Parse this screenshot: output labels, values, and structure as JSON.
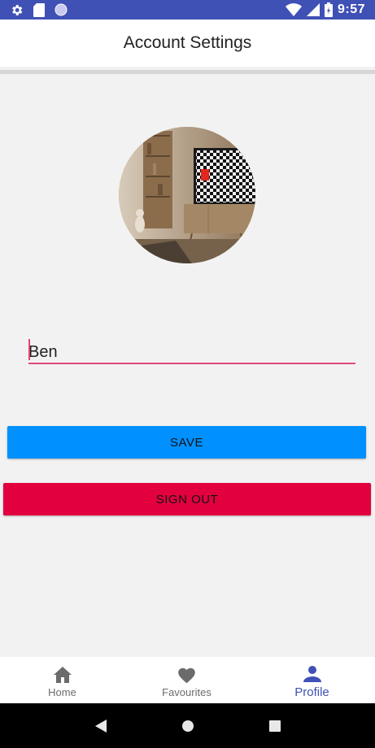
{
  "status_bar": {
    "time": "9:57",
    "bg_color": "#3f51b5",
    "icons_left": [
      "gear-icon",
      "sd-card-icon",
      "circle-notification-icon"
    ],
    "icons_right": [
      "wifi-icon",
      "signal-icon",
      "battery-icon"
    ]
  },
  "app_bar": {
    "title": "Account Settings"
  },
  "profile": {
    "avatar_alt": "profile-photo",
    "name_value": "Ben",
    "input_underline_color": "#e04a7b"
  },
  "actions": {
    "save_label": "SAVE",
    "save_color": "#0090ff",
    "signout_label": "SIGN OUT",
    "signout_color": "#e3003f"
  },
  "tab_bar": {
    "active_color": "#3f51b5",
    "items": [
      {
        "label": "Home",
        "icon": "home-icon",
        "active": false
      },
      {
        "label": "Favourites",
        "icon": "heart-icon",
        "active": false
      },
      {
        "label": "Profile",
        "icon": "person-icon",
        "active": true
      }
    ]
  },
  "nav_bar": {
    "buttons": [
      "back-icon",
      "home-circle-icon",
      "recents-icon"
    ]
  }
}
